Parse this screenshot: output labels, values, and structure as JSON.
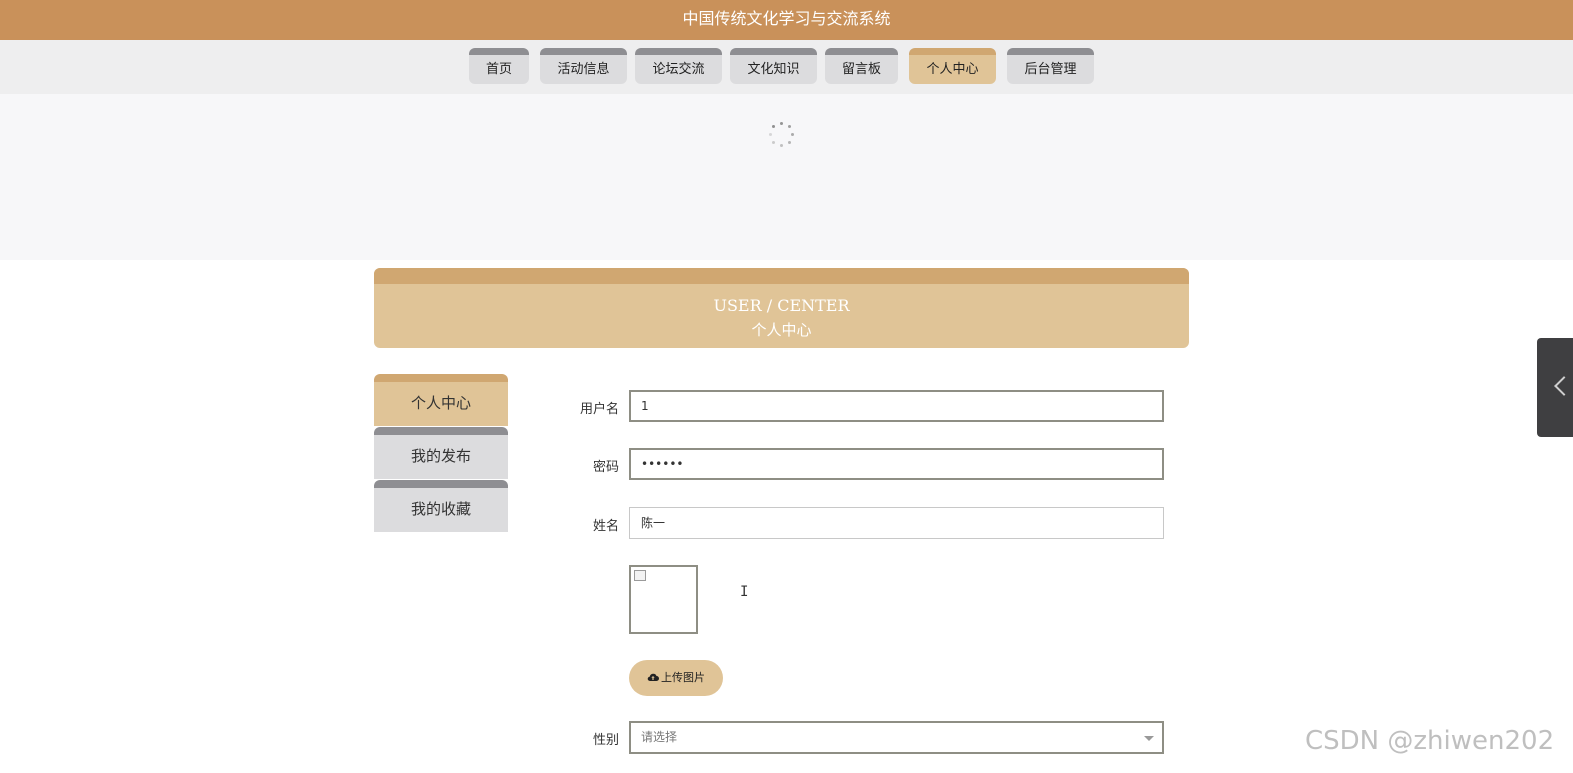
{
  "header": {
    "title": "中国传统文化学习与交流系统"
  },
  "nav": {
    "tabs": [
      {
        "label": "首页"
      },
      {
        "label": "活动信息"
      },
      {
        "label": "论坛交流"
      },
      {
        "label": "文化知识"
      },
      {
        "label": "留言板"
      },
      {
        "label": "个人中心"
      },
      {
        "label": "后台管理"
      }
    ],
    "active": "个人中心"
  },
  "section": {
    "title_en": "USER / CENTER",
    "title_cn": "个人中心"
  },
  "sidebar": {
    "items": [
      {
        "label": "个人中心"
      },
      {
        "label": "我的发布"
      },
      {
        "label": "我的收藏"
      }
    ],
    "active": "个人中心"
  },
  "form": {
    "username": {
      "label": "用户名",
      "value": "1"
    },
    "password": {
      "label": "密码",
      "value": "••••••"
    },
    "name": {
      "label": "姓名",
      "value": "陈一"
    },
    "upload": {
      "label": "上传图片"
    },
    "gender": {
      "label": "性别",
      "placeholder": "请选择"
    }
  },
  "watermark": {
    "text": "CSDN @zhiwen202"
  },
  "colors": {
    "brand": "#c9915a",
    "accent": "#e0c497",
    "tab_inactive": "#dcdcde"
  },
  "icons": [
    "loading-spinner-icon",
    "broken-image-icon",
    "text-cursor-icon",
    "cloud-upload-icon",
    "chevron-down-icon",
    "chevron-left-icon"
  ]
}
